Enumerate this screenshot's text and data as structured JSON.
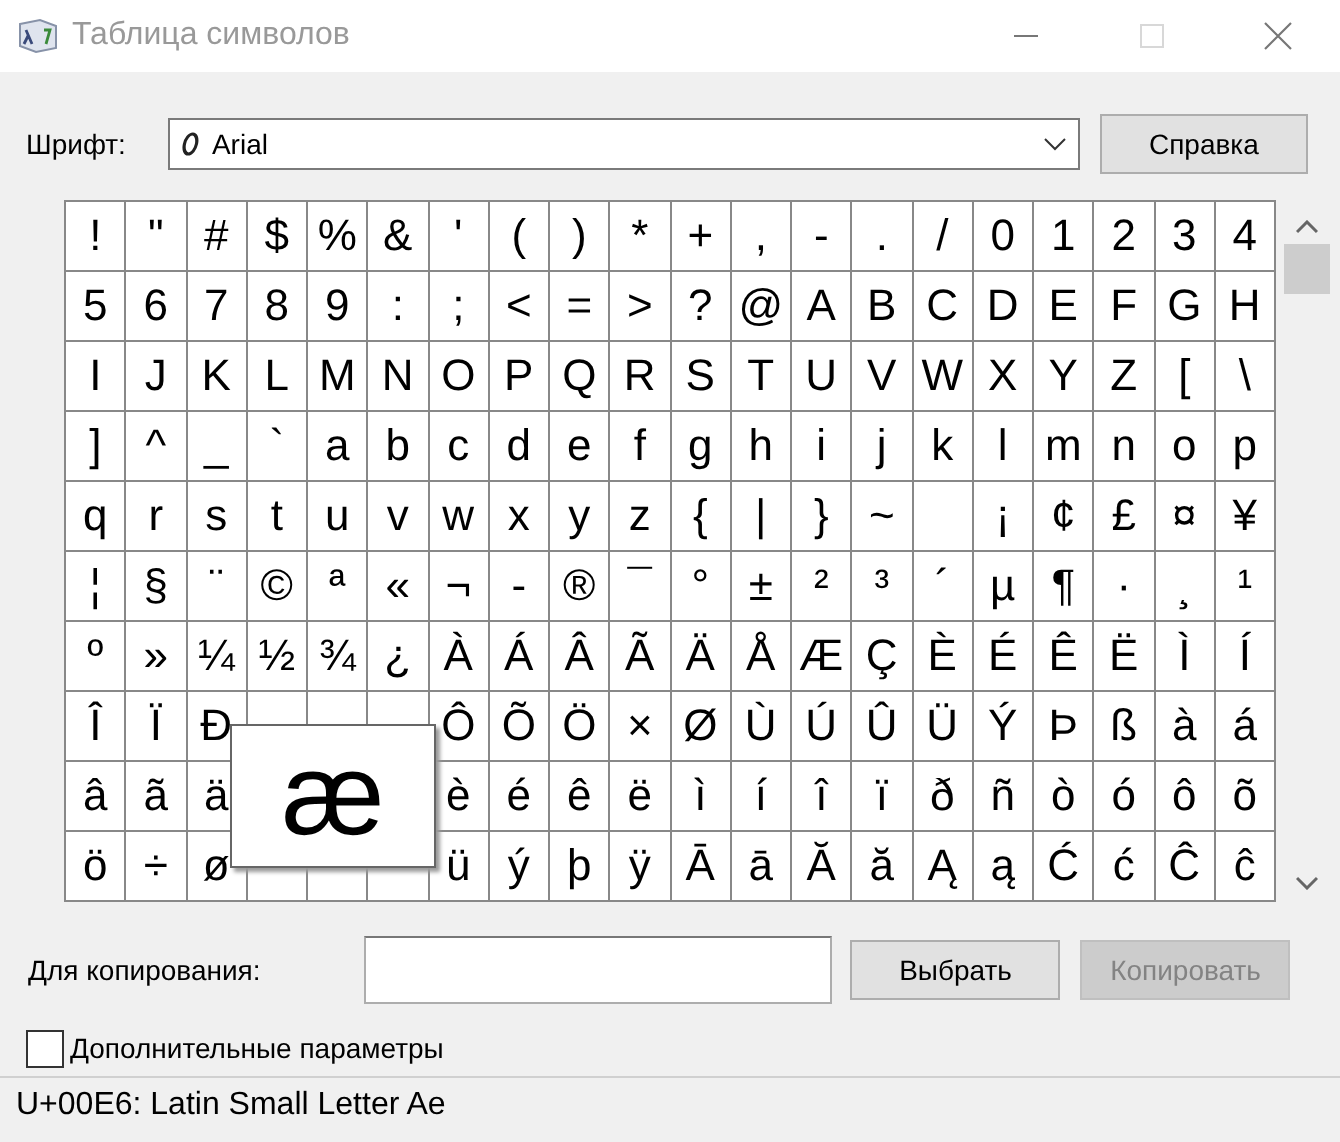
{
  "window": {
    "title": "Таблица символов",
    "controls": [
      {
        "kind": "minimize",
        "disabled": false
      },
      {
        "kind": "maximize",
        "disabled": true
      },
      {
        "kind": "close",
        "disabled": false
      }
    ]
  },
  "font": {
    "label": "Шрифт:",
    "value": "Arial"
  },
  "help_button": {
    "label": "Справка",
    "disabled": false
  },
  "grid": {
    "rows": [
      [
        "!",
        "\"",
        "#",
        "$",
        "%",
        "&",
        "'",
        "(",
        ")",
        "*",
        "+",
        ",",
        "-",
        ".",
        "/",
        "0",
        "1",
        "2",
        "3",
        "4"
      ],
      [
        "5",
        "6",
        "7",
        "8",
        "9",
        ":",
        ";",
        "<",
        "=",
        ">",
        "?",
        "@",
        "A",
        "B",
        "C",
        "D",
        "E",
        "F",
        "G",
        "H"
      ],
      [
        "I",
        "J",
        "K",
        "L",
        "M",
        "N",
        "O",
        "P",
        "Q",
        "R",
        "S",
        "T",
        "U",
        "V",
        "W",
        "X",
        "Y",
        "Z",
        "[",
        "\\"
      ],
      [
        "]",
        "^",
        "_",
        "`",
        "a",
        "b",
        "c",
        "d",
        "e",
        "f",
        "g",
        "h",
        "i",
        "j",
        "k",
        "l",
        "m",
        "n",
        "o",
        "p"
      ],
      [
        "q",
        "r",
        "s",
        "t",
        "u",
        "v",
        "w",
        "x",
        "y",
        "z",
        "{",
        "|",
        "}",
        "~",
        null,
        "¡",
        "¢",
        "£",
        "¤",
        "¥"
      ],
      [
        "¦",
        "§",
        "¨",
        "©",
        "ª",
        "«",
        "¬",
        "-",
        "®",
        "¯",
        "°",
        "±",
        "²",
        "³",
        "´",
        "µ",
        "¶",
        "·",
        "¸",
        "¹"
      ],
      [
        "º",
        "»",
        "¼",
        "½",
        "¾",
        "¿",
        "À",
        "Á",
        "Â",
        "Ã",
        "Ä",
        "Å",
        "Æ",
        "Ç",
        "È",
        "É",
        "Ê",
        "Ë",
        "Ì",
        "Í"
      ],
      [
        "Î",
        "Ï",
        "Ð",
        null,
        null,
        null,
        "Ô",
        "Õ",
        "Ö",
        "×",
        "Ø",
        "Ù",
        "Ú",
        "Û",
        "Ü",
        "Ý",
        "Þ",
        "ß",
        "à",
        "á"
      ],
      [
        "â",
        "ã",
        "ä",
        null,
        null,
        null,
        "è",
        "é",
        "ê",
        "ë",
        "ì",
        "í",
        "î",
        "ï",
        "ð",
        "ñ",
        "ò",
        "ó",
        "ô",
        "õ"
      ],
      [
        "ö",
        "÷",
        "ø",
        null,
        null,
        null,
        "ü",
        "ý",
        "þ",
        "ÿ",
        "Ā",
        "ā",
        "Ă",
        "ă",
        "Ą",
        "ą",
        "Ć",
        "ć",
        "Ĉ",
        "ĉ"
      ]
    ],
    "magnified": "æ"
  },
  "copy": {
    "label": "Для копирования:",
    "buttons": [
      {
        "label": "Выбрать",
        "disabled": false
      },
      {
        "label": "Копировать",
        "disabled": true
      }
    ]
  },
  "advanced": {
    "label": "Дополнительные параметры",
    "checked": false
  },
  "status_bar": "U+00E6: Latin Small Letter Ae"
}
